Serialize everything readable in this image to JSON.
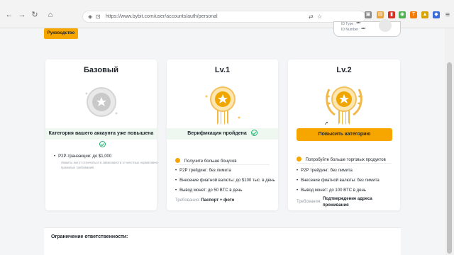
{
  "browser": {
    "url": "https://www.bybit.com/user/accounts/auth/personal",
    "url_display": "https://www.bybit.com/user/accounts/auth/personal"
  },
  "page": {
    "guide_button": "Руководство",
    "id_card": {
      "id_type_label": "ID Type :",
      "id_type_value": "***",
      "id_number_label": "ID Number :",
      "id_number_value": "***"
    }
  },
  "cards": {
    "basic": {
      "title": "Базовый",
      "status": "Категория вашего аккаунта уже повышена",
      "bullet1": "P2P-транзакции: до $1,000",
      "note": "Лимиты могут отличаться в зависимости от местных нормативно-правовых требований."
    },
    "lv1": {
      "title": "Lv.1",
      "status": "Верификация пройдена",
      "bonus": "Получите больше бонусов",
      "bullet1": "P2P трейдинг: без лимита",
      "bullet2": "Внесение фиатной валюты: до $100 тыс. в день",
      "bullet3": "Вывод монет: до 50 BTC в день",
      "req_label": "Требования:",
      "req_value": "Паспорт + фото"
    },
    "lv2": {
      "title": "Lv.2",
      "button": "Повысить категорию",
      "bonus": "Попробуйте больше торговых продуктов",
      "bullet1": "P2P трейдинг: без лимита",
      "bullet2": "Внесение фиатной валюты: без лимита",
      "bullet3": "Вывод монет: до 100 BTC в день",
      "req_label": "Требования:",
      "req_value_line1": "Подтверждение адреса",
      "req_value_line2": "проживания"
    }
  },
  "disclaimer": {
    "title": "Ограничение ответственности:"
  },
  "colors": {
    "accent": "#f7a600",
    "success": "#20b26c",
    "page_bg": "#f4f5f7"
  }
}
